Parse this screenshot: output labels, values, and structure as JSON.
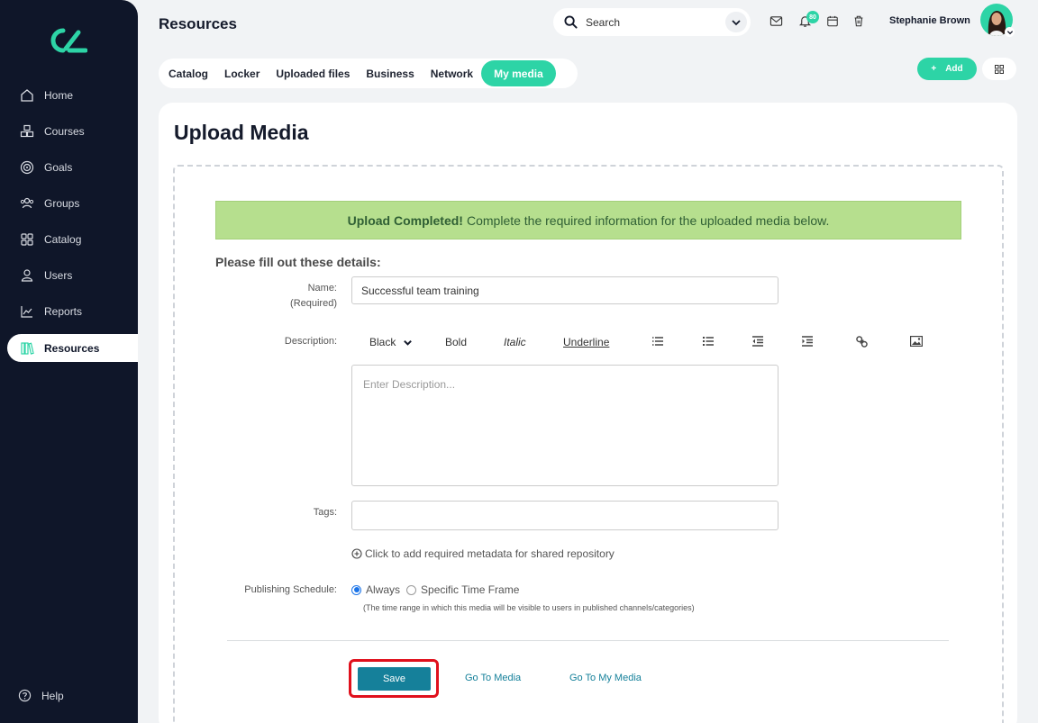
{
  "sidebar": {
    "items": [
      {
        "label": "Home",
        "icon": "home-icon"
      },
      {
        "label": "Courses",
        "icon": "courses-icon"
      },
      {
        "label": "Goals",
        "icon": "target-icon"
      },
      {
        "label": "Groups",
        "icon": "users-group-icon"
      },
      {
        "label": "Catalog",
        "icon": "catalog-grid-icon"
      },
      {
        "label": "Users",
        "icon": "user-icon"
      },
      {
        "label": "Reports",
        "icon": "chart-line-icon"
      },
      {
        "label": "Resources",
        "icon": "books-icon"
      }
    ],
    "active": "Resources",
    "help_label": "Help"
  },
  "header": {
    "title": "Resources",
    "search_placeholder": "Search",
    "notification_count": "80",
    "user_name": "Stephanie Brown"
  },
  "tabs": [
    "Catalog",
    "Locker",
    "Uploaded files",
    "Business",
    "Network",
    "My media"
  ],
  "active_tab": "My media",
  "actions": {
    "add_label": "Add"
  },
  "page": {
    "title": "Upload Media",
    "success_bold": "Upload Completed!",
    "success_text": "Complete the required information for the uploaded media below.",
    "form_heading": "Please fill out these details:"
  },
  "form": {
    "name_label": "Name:",
    "name_required": "(Required)",
    "name_value": "Successful team training",
    "description_label": "Description:",
    "toolbar": {
      "color": "Black",
      "bold": "Bold",
      "italic": "Italic",
      "underline": "Underline"
    },
    "description_placeholder": "Enter Description...",
    "tags_label": "Tags:",
    "tags_value": "",
    "metadata_link": "Click to add required metadata for shared repository",
    "schedule_label": "Publishing Schedule:",
    "schedule_options": [
      "Always",
      "Specific Time Frame"
    ],
    "schedule_selected": "Always",
    "schedule_note": "(The time range in which this media will be visible to users in published channels/categories)"
  },
  "buttons": {
    "save": "Save",
    "go_to_media": "Go To Media",
    "go_to_my_media": "Go To My Media"
  },
  "colors": {
    "sidebar_bg": "#0f1629",
    "accent": "#2dd4a6",
    "success_bg": "#b6df8e",
    "primary_button": "#15809a",
    "highlight": "#e0101c"
  }
}
